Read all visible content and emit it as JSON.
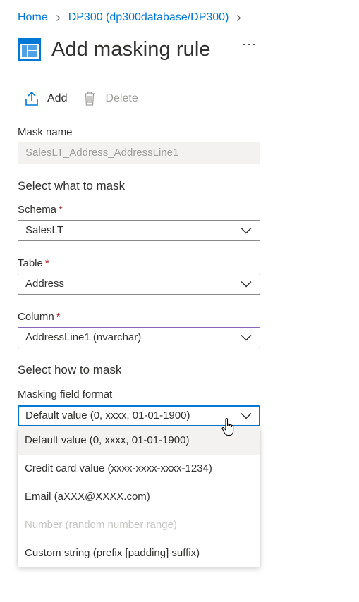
{
  "breadcrumb": {
    "items": [
      "Home",
      "DP300 (dp300database/DP300)"
    ]
  },
  "page": {
    "title": "Add masking rule",
    "more": "···"
  },
  "toolbar": {
    "add_label": "Add",
    "delete_label": "Delete"
  },
  "form": {
    "mask_name_label": "Mask name",
    "mask_name_value": "SalesLT_Address_AddressLine1",
    "section_what": "Select what to mask",
    "schema_label": "Schema",
    "schema_value": "SalesLT",
    "table_label": "Table",
    "table_value": "Address",
    "column_label": "Column",
    "column_value": "AddressLine1 (nvarchar)",
    "required_marker": "*",
    "section_how": "Select how to mask",
    "format_label": "Masking field format",
    "format_value": "Default value (0, xxxx, 01-01-1900)"
  },
  "format_options": [
    {
      "label": "Default value (0, xxxx, 01-01-1900)",
      "selected": true,
      "disabled": false
    },
    {
      "label": "Credit card value (xxxx-xxxx-xxxx-1234)",
      "selected": false,
      "disabled": false
    },
    {
      "label": "Email (aXXX@XXXX.com)",
      "selected": false,
      "disabled": false
    },
    {
      "label": "Number (random number range)",
      "selected": false,
      "disabled": true
    },
    {
      "label": "Custom string (prefix [padding] suffix)",
      "selected": false,
      "disabled": false
    }
  ],
  "colors": {
    "accent": "#0078d4",
    "required": "#a4262c",
    "column_border": "#8764b8"
  }
}
